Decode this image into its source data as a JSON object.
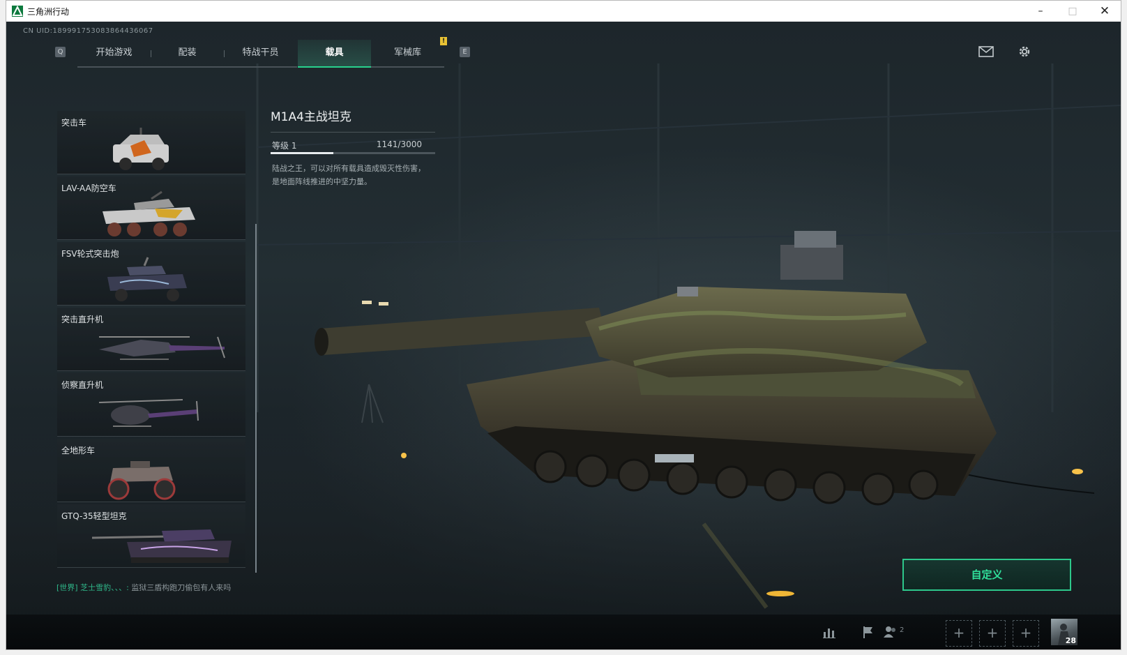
{
  "window": {
    "title": "三角洲行动",
    "minimize": "–",
    "maximize": "□",
    "close": "✕"
  },
  "uid": "CN UID:1899917530838644360​67",
  "nav": {
    "key_left": "Q",
    "key_right": "E",
    "alert": "!",
    "tabs": [
      {
        "label": "开始游戏",
        "active": false
      },
      {
        "label": "配装",
        "active": false
      },
      {
        "label": "特战干员",
        "active": false
      },
      {
        "label": "载具",
        "active": true
      },
      {
        "label": "军械库",
        "active": false
      }
    ]
  },
  "top_icons": [
    "mail-icon",
    "gear-icon"
  ],
  "vehicles": [
    {
      "name": "突击车",
      "icon": "assault-car"
    },
    {
      "name": "LAV-AA防空车",
      "icon": "anti-air-vehicle"
    },
    {
      "name": "FSV轮式突击炮",
      "icon": "wheeled-assault-gun"
    },
    {
      "name": "突击直升机",
      "icon": "attack-helicopter"
    },
    {
      "name": "侦察直升机",
      "icon": "scout-helicopter"
    },
    {
      "name": "全地形车",
      "icon": "atv"
    },
    {
      "name": "GTQ-35轻型坦克",
      "icon": "light-tank"
    }
  ],
  "selected_vehicle": {
    "name": "M1A4主战坦克",
    "level_label": "等级 1",
    "xp_current": 1141,
    "xp_max": 3000,
    "xp_text": "1141/3000",
    "description": "陆战之王，可以对所有载具造成毁灭性伤害，是地面阵线推进的中坚力量。"
  },
  "customize_button": "自定义",
  "chat": {
    "channel": "[世界]",
    "user": "芝士雪豹、、、:",
    "message": "监狱三盾构跑刀偷包有人来吗"
  },
  "bottom_bar": {
    "friends_count": "2",
    "slot_symbol": "+",
    "player_level": "28"
  },
  "colors": {
    "accent": "#28d18d",
    "background": "#1f282d",
    "alert": "#e8c234"
  }
}
